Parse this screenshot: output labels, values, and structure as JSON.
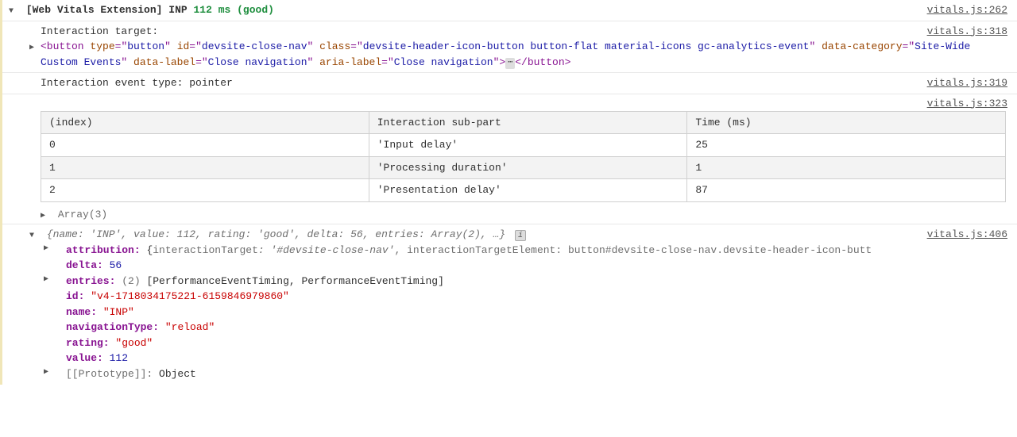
{
  "header": {
    "prefix": "[Web Vitals Extension]",
    "metric": "INP",
    "value": "112 ms",
    "rating": "(good)",
    "source": "vitals.js:262"
  },
  "target": {
    "label": "Interaction target:",
    "source": "vitals.js:318",
    "html": {
      "tag_open": "<button",
      "attrs": [
        {
          "name": "type",
          "value": "button"
        },
        {
          "name": "id",
          "value": "devsite-close-nav"
        },
        {
          "name": "class",
          "value": "devsite-header-icon-button button-flat material-icons gc-analytics-event"
        },
        {
          "name": "data-category",
          "value": "Site-Wide Custom Events"
        },
        {
          "name": "data-label",
          "value": "Close navigation"
        },
        {
          "name": "aria-label",
          "value": "Close navigation"
        }
      ],
      "ellipsis": "⋯",
      "tag_close": "</button>"
    }
  },
  "event_type": {
    "label": "Interaction event type: pointer",
    "source": "vitals.js:319"
  },
  "table": {
    "source": "vitals.js:323",
    "headers": [
      "(index)",
      "Interaction sub-part",
      "Time (ms)"
    ],
    "rows": [
      [
        "0",
        "'Input delay'",
        "25"
      ],
      [
        "1",
        "'Processing duration'",
        "1"
      ],
      [
        "2",
        "'Presentation delay'",
        "87"
      ]
    ],
    "array_label": "Array(3)"
  },
  "obj": {
    "source": "vitals.js:406",
    "summary_prefix": "{",
    "summary_italic": "name: 'INP', value: 112, rating: 'good', delta: 56, entries: Array(2), …",
    "summary_suffix": "}",
    "attribution": {
      "key": "attribution:",
      "open": "{",
      "k1": "interactionTarget",
      "v1": "'#devsite-close-nav'",
      "k2": "interactionTargetElement",
      "v2_sel": "button#devsite-close-nav.devsite-header-icon-butt",
      "close": ""
    },
    "props": {
      "delta_k": "delta:",
      "delta_v": "56",
      "entries_k": "entries:",
      "entries_hint": "(2)",
      "entries_v": "[PerformanceEventTiming, PerformanceEventTiming]",
      "id_k": "id:",
      "id_v": "\"v4-1718034175221-6159846979860\"",
      "name_k": "name:",
      "name_v": "\"INP\"",
      "nav_k": "navigationType:",
      "nav_v": "\"reload\"",
      "rating_k": "rating:",
      "rating_v": "\"good\"",
      "value_k": "value:",
      "value_v": "112",
      "proto_k": "[[Prototype]]:",
      "proto_v": "Object"
    }
  }
}
